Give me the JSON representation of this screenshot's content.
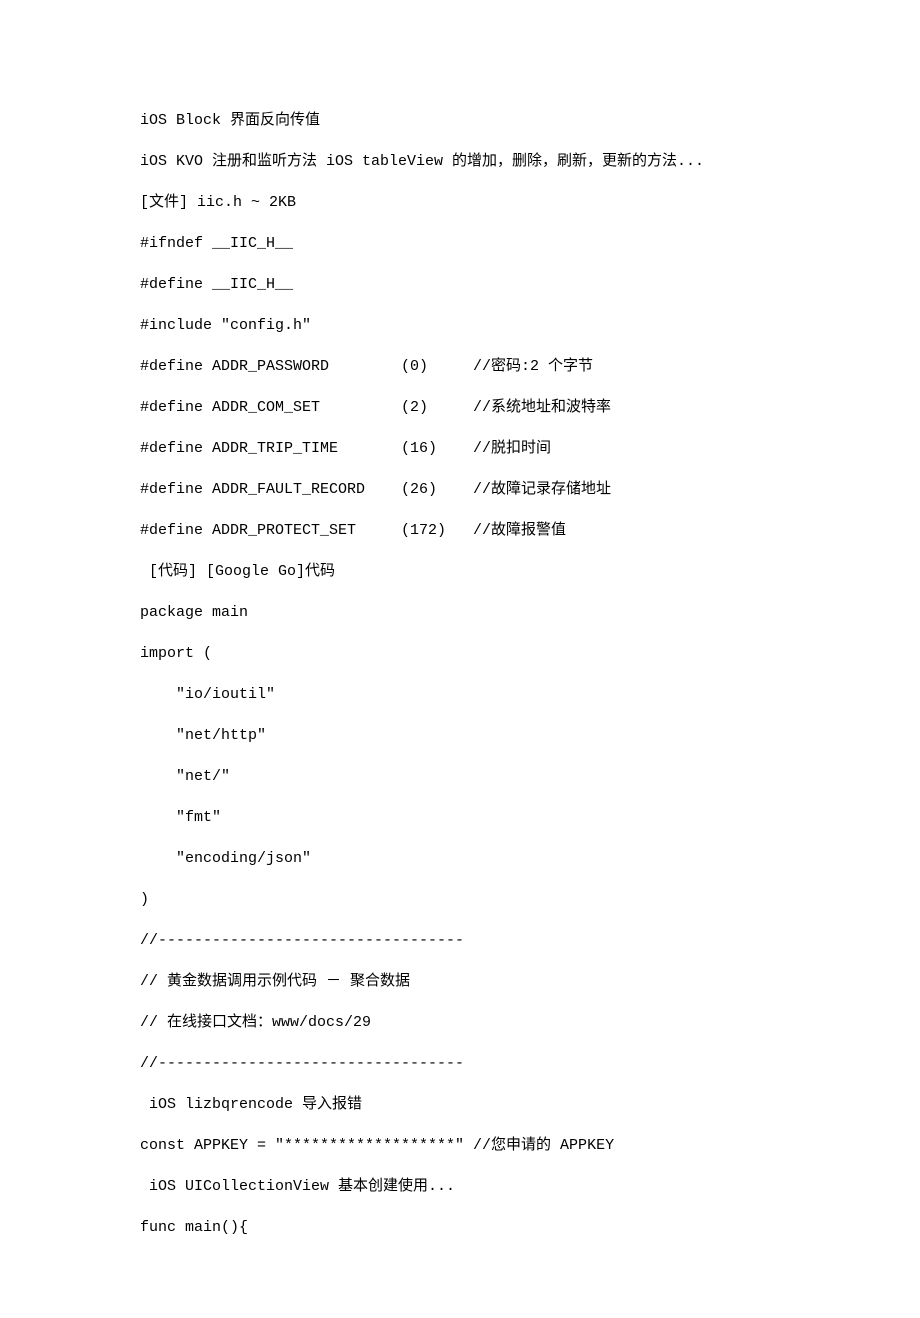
{
  "lines": [
    "iOS Block 界面反向传值",
    "iOS KVO 注册和监听方法 iOS tableView 的增加，删除，刷新，更新的方法...",
    "[文件] iic.h ~ 2KB",
    "#ifndef __IIC_H__",
    "#define __IIC_H__",
    "#include \"config.h\"",
    "#define ADDR_PASSWORD        (0)     //密码:2 个字节",
    "#define ADDR_COM_SET         (2)     //系统地址和波特率",
    "#define ADDR_TRIP_TIME       (16)    //脱扣时间",
    "#define ADDR_FAULT_RECORD    (26)    //故障记录存储地址",
    "#define ADDR_PROTECT_SET     (172)   //故障报警值",
    " [代码] [Google Go]代码",
    "package main",
    "import (",
    "    \"io/ioutil\"",
    "    \"net/http\"",
    "    \"net/\"",
    "    \"fmt\"",
    "    \"encoding/json\"",
    ")",
    "//----------------------------------",
    "// 黄金数据调用示例代码 － 聚合数据",
    "// 在线接口文档：www/docs/29",
    "//----------------------------------",
    " iOS lizbqrencode 导入报错",
    "const APPKEY = \"*******************\" //您申请的 APPKEY",
    " iOS UICollectionView 基本创建使用...",
    "func main(){"
  ]
}
